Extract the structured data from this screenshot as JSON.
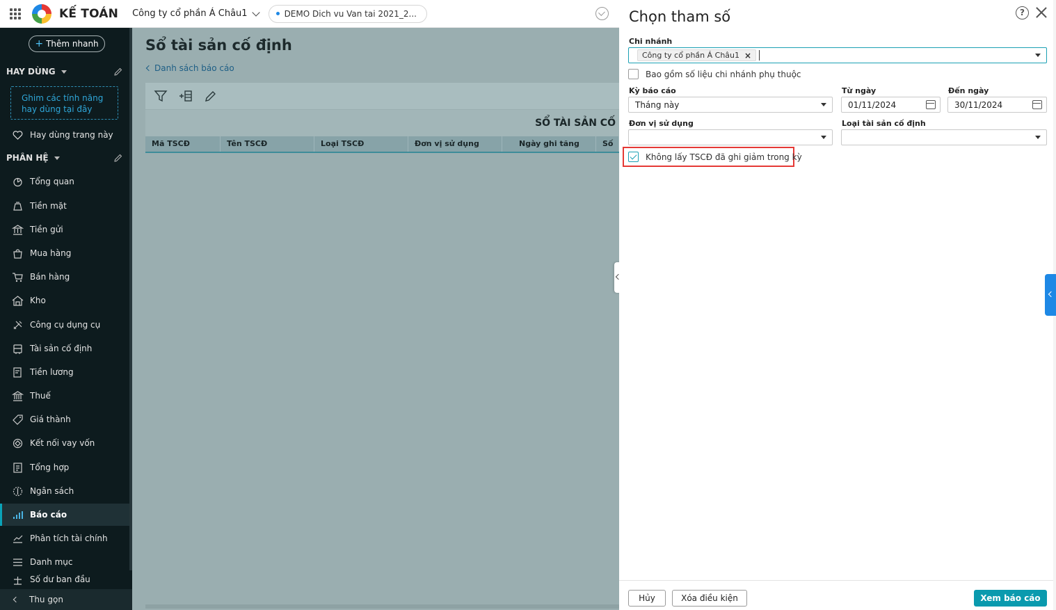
{
  "header": {
    "brand": "KẾ TOÁN",
    "company": "Công ty cổ phần Á Châu1",
    "database": "DEMO Dich vu Van tai 2021_2..."
  },
  "sidebar": {
    "quick_add": "Thêm nhanh",
    "favorites_title": "HAY DÙNG",
    "pin_hint": "Ghim các tính năng hay dùng tại đây",
    "favorite_this_page": "Hay dùng trang này",
    "modules_title": "PHÂN HỆ",
    "items": [
      {
        "label": "Tổng quan",
        "icon": "overview-icon"
      },
      {
        "label": "Tiền mặt",
        "icon": "cash-icon"
      },
      {
        "label": "Tiền gửi",
        "icon": "bank-deposit-icon"
      },
      {
        "label": "Mua hàng",
        "icon": "purchase-bag-icon"
      },
      {
        "label": "Bán hàng",
        "icon": "cart-icon"
      },
      {
        "label": "Kho",
        "icon": "warehouse-icon"
      },
      {
        "label": "Công cụ dụng cụ",
        "icon": "tools-icon"
      },
      {
        "label": "Tài sản cố định",
        "icon": "fixed-asset-icon"
      },
      {
        "label": "Tiền lương",
        "icon": "payroll-icon"
      },
      {
        "label": "Thuế",
        "icon": "tax-icon"
      },
      {
        "label": "Giá thành",
        "icon": "price-tag-icon"
      },
      {
        "label": "Kết nối vay vốn",
        "icon": "loan-icon"
      },
      {
        "label": "Tổng hợp",
        "icon": "summary-icon"
      },
      {
        "label": "Ngân sách",
        "icon": "budget-icon"
      },
      {
        "label": "Báo cáo",
        "icon": "report-chart-icon"
      },
      {
        "label": "Phân tích tài chính",
        "icon": "analytics-icon"
      },
      {
        "label": "Danh mục",
        "icon": "list-icon"
      },
      {
        "label": "Số dư ban đầu",
        "icon": "balance-icon"
      }
    ],
    "active_item": "Báo cáo",
    "collapse": "Thu gọn"
  },
  "main": {
    "title": "Sổ tài sản cố định",
    "back_link": "Danh sách báo cáo",
    "report_heading": "SỔ TÀI SẢN CỐ",
    "columns": [
      "Mã TSCĐ",
      "Tên TSCĐ",
      "Loại TSCĐ",
      "Đơn vị sử dụng",
      "Ngày ghi tăng",
      "Số C"
    ]
  },
  "panel": {
    "title": "Chọn tham số",
    "branch_label": "Chi nhánh",
    "branch_tag": "Công ty cổ phần Á Châu1",
    "include_sub_branch": "Bao gồm số liệu chi nhánh phụ thuộc",
    "include_sub_branch_checked": false,
    "period_label": "Kỳ báo cáo",
    "period_value": "Tháng này",
    "from_label": "Từ ngày",
    "from_value": "01/11/2024",
    "to_label": "Đến ngày",
    "to_value": "30/11/2024",
    "dept_label": "Đơn vị sử dụng",
    "dept_value": "",
    "asset_type_label": "Loại tài sản cố định",
    "asset_type_value": "",
    "exclude_reduced": "Không lấy TSCĐ đã ghi giảm trong kỳ",
    "exclude_reduced_checked": true,
    "cancel": "Hủy",
    "clear": "Xóa điều kiện",
    "view": "Xem báo cáo"
  },
  "colors": {
    "accent": "#0a9aae",
    "sidebar_bg": "#0d1b1e",
    "highlight": "#e53935"
  }
}
